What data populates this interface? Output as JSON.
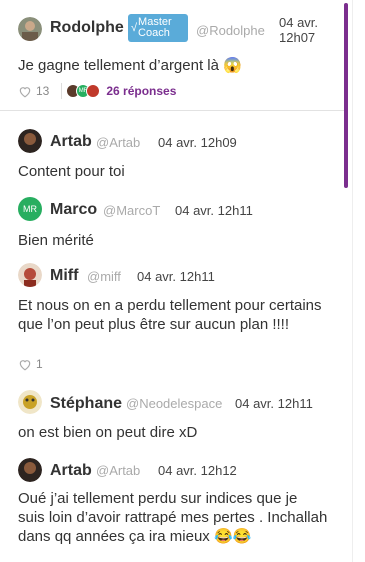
{
  "post": {
    "author": "Rodolphe",
    "badge": "Master Coach",
    "handle": "@Rodolphe",
    "time": "04 avr. 12h07",
    "text": "Je gagne tellement d’argent là 😱",
    "likes": "13",
    "replies_label": "26 réponses"
  },
  "replies": [
    {
      "author": "Artab",
      "handle": "@Artab",
      "time": "04 avr. 12h09",
      "text": "Content pour toi"
    },
    {
      "author": "Marco",
      "initials": "MR",
      "handle": "@MarcoT",
      "time": "04 avr. 12h11",
      "text": "Bien mérité"
    },
    {
      "author": "Miff",
      "handle": "@miff",
      "time": "04 avr. 12h11",
      "text": "Et nous on en a perdu tellement pour certains que l’on peut plus être sur aucun plan !!!!",
      "likes": "1"
    },
    {
      "author": "Stéphane",
      "handle": "@Neodelespace",
      "time": "04 avr. 12h11",
      "text": "on est bien on peut dire xD"
    },
    {
      "author": "Artab",
      "handle": "@Artab",
      "time": "04 avr. 12h12",
      "text": "Oué j’ai tellement perdu sur indices que je suis loin d’avoir rattrapé mes pertes . Inchallah dans qq années ça ira mieux 😂😂"
    }
  ],
  "colors": {
    "accent": "#7b2e8e",
    "badge": "#5aabd9",
    "marco_avatar": "#27ae60"
  }
}
